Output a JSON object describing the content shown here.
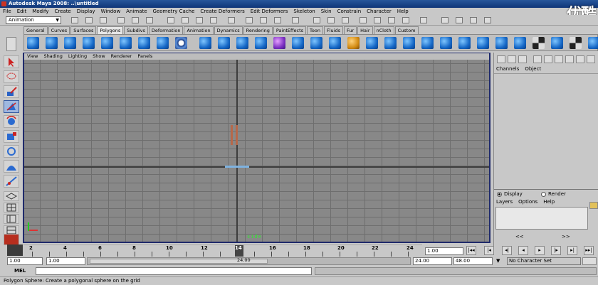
{
  "window": {
    "title": "Autodesk Maya 2008: ..\\untitled"
  },
  "watermark": "优酷",
  "menubar": [
    "File",
    "Edit",
    "Modify",
    "Create",
    "Display",
    "Window",
    "Animate",
    "Geometry Cache",
    "Create Deformers",
    "Edit Deformers",
    "Skeleton",
    "Skin",
    "Constrain",
    "Character",
    "Help"
  ],
  "statusline": {
    "mode": "Animation"
  },
  "shelf_tabs": [
    "General",
    "Curves",
    "Surfaces",
    "Polygons",
    "Subdivs",
    "Deformation",
    "Animation",
    "Dynamics",
    "Rendering",
    "PaintEffects",
    "Toon",
    "Fluids",
    "Fur",
    "Hair",
    "nCloth",
    "Custom"
  ],
  "shelf_active": "Polygons",
  "viewport": {
    "menu": [
      "View",
      "Shading",
      "Lighting",
      "Show",
      "Renderer",
      "Panels"
    ],
    "label": "side"
  },
  "channelbox": {
    "tabs": [
      "Channels",
      "Object"
    ]
  },
  "layers": {
    "display_label": "Display",
    "render_label": "Render",
    "menu": [
      "Layers",
      "Options",
      "Help"
    ]
  },
  "timeline": {
    "ticks": [
      "2",
      "4",
      "6",
      "8",
      "10",
      "12",
      "14",
      "16",
      "18",
      "20",
      "22",
      "24"
    ],
    "current_time": "1.00"
  },
  "range": {
    "start_time": "1.00",
    "start_range": "1.00",
    "slider_value": "24.00",
    "end_range": "24.00",
    "end_time": "48.00",
    "character_set": "No Character Set"
  },
  "command_line": {
    "label": "MEL"
  },
  "help_line": "Polygon Sphere: Create a polygonal sphere on the grid"
}
